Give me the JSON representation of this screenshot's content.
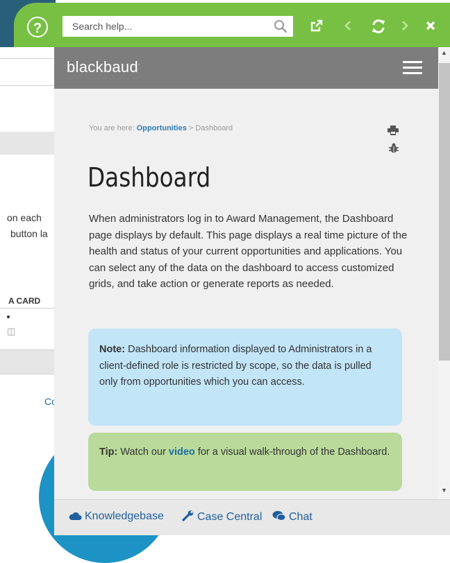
{
  "background": {
    "line1": "on each",
    "line2": "button la",
    "card_label": "A CARD",
    "link_text": "Co"
  },
  "help_bar": {
    "help_glyph": "?",
    "search_placeholder": "Search help...",
    "icons": [
      "help-icon",
      "search-icon",
      "external-link-icon",
      "back-icon",
      "refresh-icon",
      "forward-icon",
      "close-icon"
    ]
  },
  "header": {
    "logo": "blackbaud",
    "logo_mark": "·"
  },
  "breadcrumb": {
    "prefix": "You are here: ",
    "link": "Opportunities",
    "separator": " > ",
    "current": "Dashboard"
  },
  "page": {
    "title": "Dashboard",
    "intro": "When administrators log in to Award Management, the Dashboard page displays by default. This page displays a real time picture of the health and status of your current opportunities and applications. You can select any of the data on the dashboard to access customized grids, and take action or generate reports as needed.",
    "note_label": "Note:",
    "note_text": " Dashboard information displayed to Administrators in a client-defined role is restricted by scope, so the data is pulled only from opportunities which you can access.",
    "tip_label": "Tip:",
    "tip_text_before": " Watch our ",
    "tip_link": "video",
    "tip_text_after": " for a visual walk-through of the Dashboard."
  },
  "footer": {
    "knowledgebase": "Knowledgebase",
    "case_central": "Case Central",
    "chat": "Chat"
  },
  "colors": {
    "accent_green": "#77c043",
    "header_gray": "#7d7d7d",
    "note_blue": "#c2e5f8",
    "tip_green": "#b9da9a",
    "link_blue": "#1e6fa3"
  }
}
